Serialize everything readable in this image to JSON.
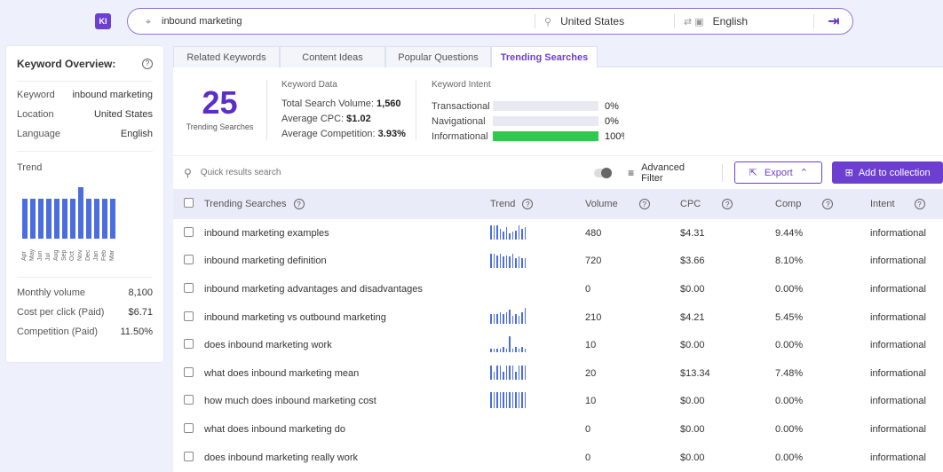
{
  "topbar": {
    "logo": "KI",
    "query": "inbound marketing",
    "location": "United States",
    "language": "English"
  },
  "overview": {
    "title": "Keyword Overview:",
    "rows": [
      {
        "k": "Keyword",
        "v": "inbound marketing"
      },
      {
        "k": "Location",
        "v": "United States"
      },
      {
        "k": "Language",
        "v": "English"
      }
    ],
    "trend_label": "Trend",
    "trend_months": [
      "Apr",
      "May",
      "Jun",
      "Jul",
      "Aug",
      "Sep",
      "Oct",
      "Nov",
      "Dec",
      "Jan",
      "Feb",
      "Mar"
    ],
    "trend_values": [
      0.78,
      0.78,
      0.78,
      0.78,
      0.78,
      0.78,
      0.78,
      1.0,
      0.78,
      0.78,
      0.78,
      0.78
    ],
    "stats": [
      {
        "k": "Monthly volume",
        "v": "8,100"
      },
      {
        "k": "Cost per click (Paid)",
        "v": "$6.71"
      },
      {
        "k": "Competition (Paid)",
        "v": "11.50%"
      }
    ]
  },
  "tabs": [
    {
      "label": "Related Keywords",
      "active": false
    },
    {
      "label": "Content Ideas",
      "active": false
    },
    {
      "label": "Popular Questions",
      "active": false
    },
    {
      "label": "Trending Searches",
      "active": true
    }
  ],
  "summary": {
    "count": "25",
    "count_label": "Trending Searches",
    "kd_title": "Keyword Data",
    "kd": [
      {
        "k": "Total Search Volume:",
        "v": "1,560"
      },
      {
        "k": "Average CPC:",
        "v": "$1.02"
      },
      {
        "k": "Average Competition:",
        "v": "3.93%"
      }
    ],
    "ki_title": "Keyword Intent",
    "ki": [
      {
        "k": "Transactional",
        "p": "0%",
        "fill": 0
      },
      {
        "k": "Navigational",
        "p": "0%",
        "fill": 0
      },
      {
        "k": "Informational",
        "p": "100%",
        "fill": 1
      }
    ]
  },
  "toolbar": {
    "search_placeholder": "Quick results search",
    "advanced_filter": "Advanced Filter",
    "export": "Export",
    "add_collection": "Add to collection"
  },
  "table": {
    "headers": [
      "Trending Searches",
      "Trend",
      "Volume",
      "CPC",
      "Comp",
      "Intent"
    ],
    "rows": [
      {
        "kw": "inbound marketing examples",
        "trend": [
          0.9,
          0.9,
          0.9,
          0.7,
          0.5,
          0.8,
          0.4,
          0.5,
          0.6,
          0.9,
          0.7,
          0.8
        ],
        "vol": "480",
        "cpc": "$4.31",
        "comp": "9.44%",
        "intent": "informational"
      },
      {
        "kw": "inbound marketing definition",
        "trend": [
          0.9,
          0.9,
          0.8,
          0.9,
          0.7,
          0.8,
          0.7,
          0.9,
          0.6,
          0.7,
          0.6,
          0.6
        ],
        "vol": "720",
        "cpc": "$3.66",
        "comp": "8.10%",
        "intent": "informational"
      },
      {
        "kw": "inbound marketing advantages and disadvantages",
        "trend": [],
        "vol": "0",
        "cpc": "$0.00",
        "comp": "0.00%",
        "intent": "informational"
      },
      {
        "kw": "inbound marketing vs outbound marketing",
        "trend": [
          0.6,
          0.6,
          0.6,
          0.7,
          0.6,
          0.7,
          0.9,
          0.5,
          0.6,
          0.5,
          0.7,
          1.0
        ],
        "vol": "210",
        "cpc": "$4.21",
        "comp": "5.45%",
        "intent": "informational"
      },
      {
        "kw": "does inbound marketing work",
        "trend": [
          0.2,
          0.2,
          0.2,
          0.2,
          0.3,
          0.2,
          1.0,
          0.2,
          0.3,
          0.2,
          0.3,
          0.2
        ],
        "vol": "10",
        "cpc": "$0.00",
        "comp": "0.00%",
        "intent": "informational"
      },
      {
        "kw": "what does inbound marketing mean",
        "trend": [
          0.9,
          0.5,
          0.9,
          0.9,
          0.5,
          0.9,
          0.9,
          0.9,
          0.5,
          0.9,
          0.9,
          0.9
        ],
        "vol": "20",
        "cpc": "$13.34",
        "comp": "7.48%",
        "intent": "informational"
      },
      {
        "kw": "how much does inbound marketing cost",
        "trend": [
          1,
          1,
          1,
          1,
          1,
          1,
          1,
          1,
          1,
          1,
          1,
          1
        ],
        "vol": "10",
        "cpc": "$0.00",
        "comp": "0.00%",
        "intent": "informational"
      },
      {
        "kw": "what does inbound marketing do",
        "trend": [],
        "vol": "0",
        "cpc": "$0.00",
        "comp": "0.00%",
        "intent": "informational"
      },
      {
        "kw": "does inbound marketing really work",
        "trend": [],
        "vol": "0",
        "cpc": "$0.00",
        "comp": "0.00%",
        "intent": "informational"
      }
    ]
  }
}
